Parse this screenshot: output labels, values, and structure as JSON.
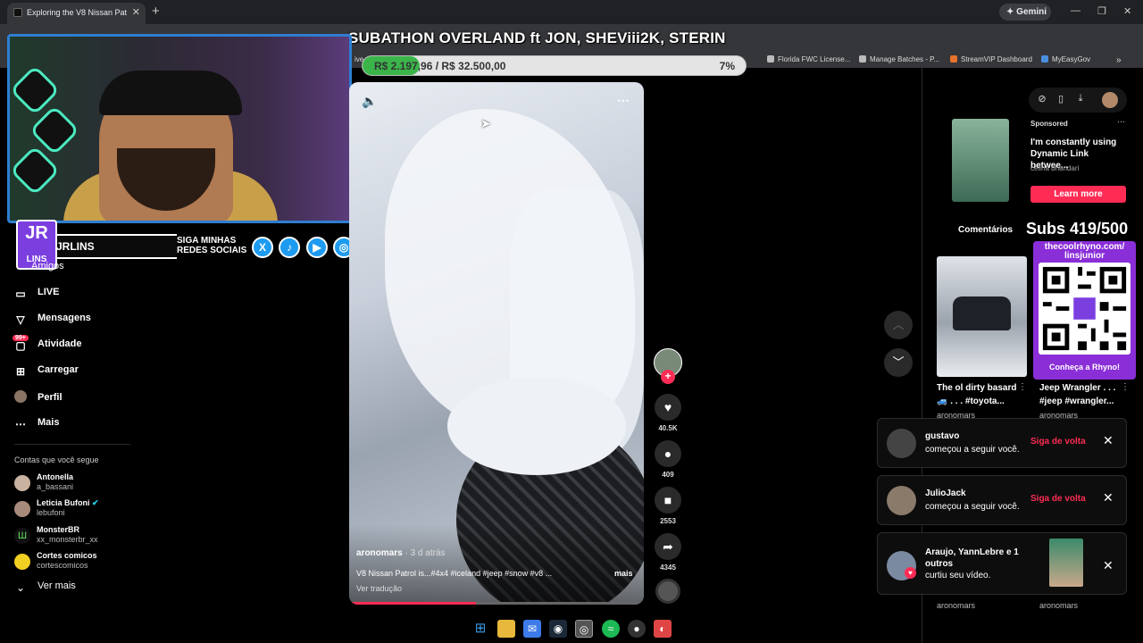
{
  "browser": {
    "tab_title": "Exploring the V8 Nissan Pat",
    "new_tab": "+",
    "gemini_label": "Gemini",
    "bookmarks": [
      "Florida FWC License...",
      "Manage Batches - P...",
      "StreamVIP Dashboard",
      "MyEasyGov"
    ],
    "bookmark_fragment": "ive"
  },
  "overlay": {
    "subathon_title": "SUBATHON OVERLAND ft JON, SHEViii2K, STERIN",
    "progress_text": "R$ 2.197,96 / R$ 32.500,00",
    "progress_pct": "7%",
    "progress_fraction": 0.07,
    "streamer_logo": "JR",
    "streamer_logo_sub": "LINS",
    "streamer_name": "JRLINS",
    "social_cta_line1": "SIGA MINHAS",
    "social_cta_line2": "REDES SOCIAIS",
    "subs_count": "Subs 419/500",
    "qr_url_line1": "thecoolrhyno.com/",
    "qr_url_line2": "linsjunior",
    "qr_cta": "Conheça a Rhyno!"
  },
  "sidebar": {
    "items": [
      {
        "label": "Amigos",
        "icon": "friends-icon"
      },
      {
        "label": "LIVE",
        "icon": "live-icon"
      },
      {
        "label": "Mensagens",
        "icon": "messages-icon"
      },
      {
        "label": "Atividade",
        "icon": "activity-icon",
        "badge": "99+"
      },
      {
        "label": "Carregar",
        "icon": "upload-icon"
      },
      {
        "label": "Perfil",
        "icon": "profile-icon"
      },
      {
        "label": "Mais",
        "icon": "more-icon"
      }
    ],
    "following_header": "Contas que você segue",
    "following": [
      {
        "name": "Antonella",
        "user": "a_bassani"
      },
      {
        "name": "Leticia Bufoni",
        "user": "lebufoni",
        "verified": true
      },
      {
        "name": "MonsterBR",
        "user": "xx_monsterbr_xx"
      },
      {
        "name": "Cortes comicos",
        "user": "cortescomicos"
      }
    ],
    "see_more": "Ver mais"
  },
  "video": {
    "author": "aronomars",
    "time_ago": " · 3 d atrás",
    "caption": "V8 Nissan Patrol is...#4x4 #iceland #jeep #snow #v8 ...",
    "more": "mais",
    "translate": "Ver tradução",
    "progress_fraction": 0.43,
    "likes": "40.5K",
    "comments": "409",
    "saves": "2553",
    "shares": "4345"
  },
  "right_panel": {
    "ad": {
      "sponsored": "Sponsored",
      "title": "I'm constantly using Dynamic Link betwee...",
      "author": "celina bhandari",
      "cta": "Learn more"
    },
    "tab_comments": "Comentários",
    "related": [
      {
        "title": "The ol dirty basard",
        "subtitle": "🚙 . . . #toyota...",
        "author": "aronomars"
      },
      {
        "title": "Jeep Wrangler . . .",
        "subtitle": "#jeep #wrangler...",
        "author": "aronomars"
      }
    ],
    "bottom_authors": [
      "aronomars",
      "aronomars"
    ]
  },
  "notifications": [
    {
      "name": "gustavo",
      "message": "começou a seguir você.",
      "action": "Siga de volta"
    },
    {
      "name": "JulioJack",
      "message": "começou a seguir você.",
      "action": "Siga de volta"
    },
    {
      "name": "Araujo, YannLebre e 1",
      "name2": "outros",
      "message": "curtiu seu vídeo."
    }
  ],
  "colors": {
    "accent": "#fe2c55",
    "progress_green": "#3bb54a",
    "qr_purple": "#8a2ed8",
    "webcam_border": "#2e7ed1"
  }
}
